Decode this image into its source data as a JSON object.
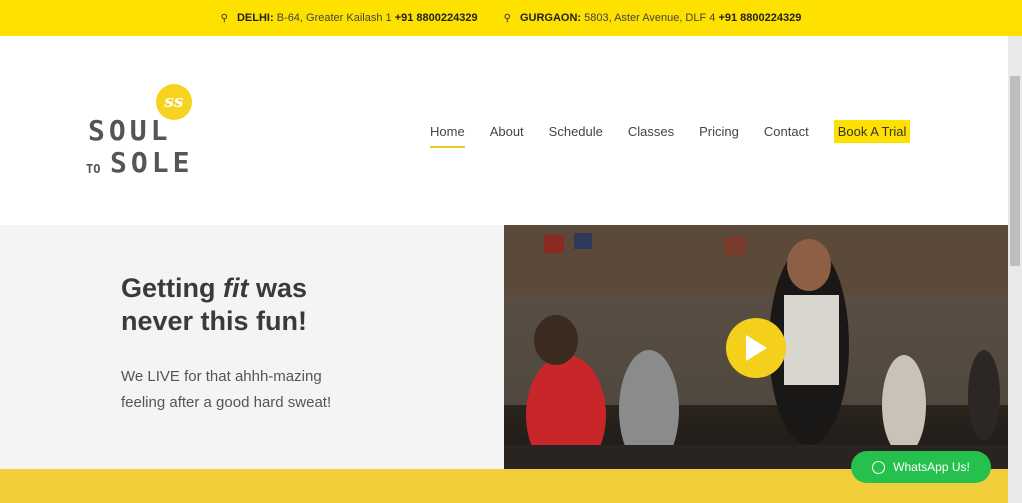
{
  "topbar": {
    "locations": [
      {
        "city": "DELHI:",
        "address": "B-64, Greater Kailash 1",
        "phone": "+91 8800224329"
      },
      {
        "city": "GURGAON:",
        "address": "5803, Aster Avenue, DLF 4",
        "phone": "+91 8800224329"
      }
    ],
    "icon": "map-pin-icon"
  },
  "logo": {
    "badge": "ss",
    "line1": "SOUL",
    "to": "TO",
    "line2": "SOLE"
  },
  "nav": {
    "items": [
      {
        "label": "Home",
        "active": true
      },
      {
        "label": "About"
      },
      {
        "label": "Schedule"
      },
      {
        "label": "Classes"
      },
      {
        "label": "Pricing"
      },
      {
        "label": "Contact"
      }
    ],
    "cta": "Book A Trial"
  },
  "hero": {
    "headline_pre": "Getting ",
    "headline_em": "fit",
    "headline_post": " was",
    "headline_line2": "never this fun!",
    "sub_line1": "We LIVE for that ahhh-mazing",
    "sub_line2": "feeling after a good hard sweat!"
  },
  "video": {
    "icon": "play-icon"
  },
  "whatsapp": {
    "label": "WhatsApp Us!",
    "icon": "whatsapp-icon"
  },
  "colors": {
    "accent": "#ffe100",
    "play": "#f4cf1b",
    "whatsapp": "#25c04e"
  }
}
